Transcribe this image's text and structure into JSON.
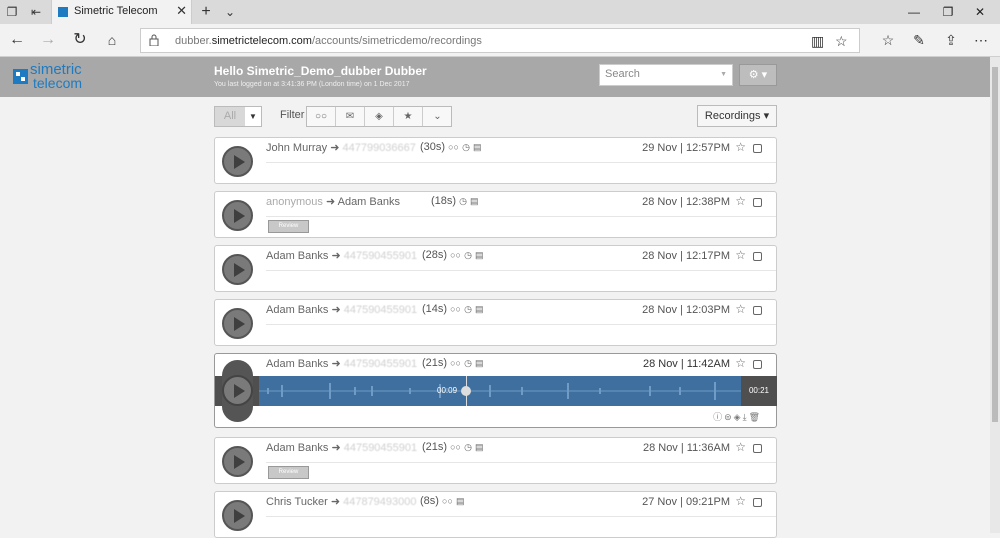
{
  "browser": {
    "tab_title": "Simetric Telecom",
    "url_prefix": "dubber.",
    "url_domain": "simetrictelecom.com",
    "url_path": "/accounts/simetricdemo/recordings"
  },
  "header": {
    "logo_line1": "simetric",
    "logo_line2": "telecom",
    "greeting": "Hello Simetric_Demo_dubber Dubber",
    "last_login": "You last logged on at 3:41:36 PM (London time) on 1 Dec 2017",
    "search_placeholder": "Search"
  },
  "controls": {
    "all_label": "All",
    "filter_label": "Filter",
    "recordings_label": "Recordings ▾"
  },
  "recordings": [
    {
      "from": "John Murray",
      "to": "447799036667",
      "duration": "(30s)",
      "date": "29 Nov | 12:57PM",
      "review": ""
    },
    {
      "from": "anonymous",
      "to": "Adam Banks",
      "duration": "(18s)",
      "date": "28 Nov | 12:38PM",
      "review": "Review"
    },
    {
      "from": "Adam Banks",
      "to": "447590455901",
      "duration": "(28s)",
      "date": "28 Nov | 12:17PM",
      "review": ""
    },
    {
      "from": "Adam Banks",
      "to": "447590455901",
      "duration": "(14s)",
      "date": "28 Nov | 12:03PM",
      "review": ""
    },
    {
      "from": "Adam Banks",
      "to": "447590455901",
      "duration": "(21s)",
      "date": "28 Nov | 11:42AM",
      "review": "",
      "player_current": "00:09",
      "player_total": "00:21",
      "progress": 0.43
    },
    {
      "from": "Adam Banks",
      "to": "447590455901",
      "duration": "(21s)",
      "date": "28 Nov | 11:36AM",
      "review": "Review"
    },
    {
      "from": "Chris Tucker",
      "to": "447879493000",
      "duration": "(8s)",
      "date": "27 Nov | 09:21PM",
      "review": ""
    }
  ]
}
